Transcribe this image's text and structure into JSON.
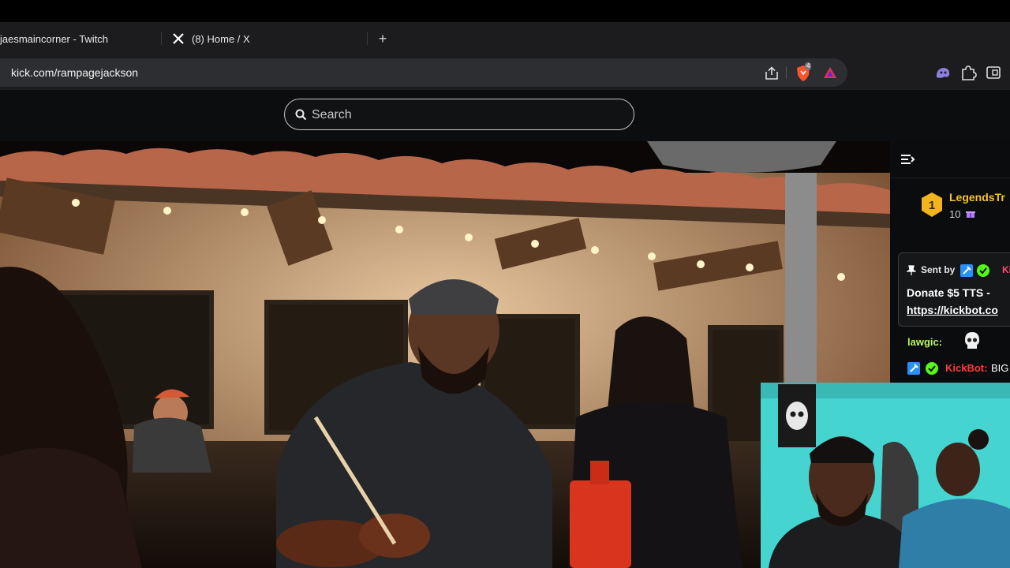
{
  "browser": {
    "tabs": [
      {
        "label": "jaesmaincorner - Twitch"
      },
      {
        "label": "(8) Home / X"
      }
    ],
    "new_tab_label": "+",
    "url": "kick.com/rampagejackson",
    "brave_badge": "4",
    "icons": [
      "x-logo-icon",
      "share-icon",
      "brave-shields-icon",
      "brave-rewards-icon",
      "extension-ghost-icon",
      "puzzle-extensions-icon",
      "sidebar-toggle-icon"
    ]
  },
  "site": {
    "search_placeholder": "Search"
  },
  "chat": {
    "subscription": {
      "name": "LegendsTr",
      "count": "10",
      "badge_level": "1"
    },
    "pinned": {
      "sent_by_label": "Sent by",
      "user": "Kic",
      "message": "Donate $5 TTS -",
      "link": "https://kickbot.co"
    },
    "messages": [
      {
        "user": "lawgic:",
        "text": ""
      },
      {
        "user": "KickBot:",
        "text": "BIG"
      }
    ]
  },
  "colors": {
    "sub_name": "#f4c23a",
    "kickbot_red": "#ff3b3b",
    "lawgic_green": "#b9f26b",
    "brave_orange": "#fb542b",
    "webcam_wall": "#45d4d0"
  }
}
